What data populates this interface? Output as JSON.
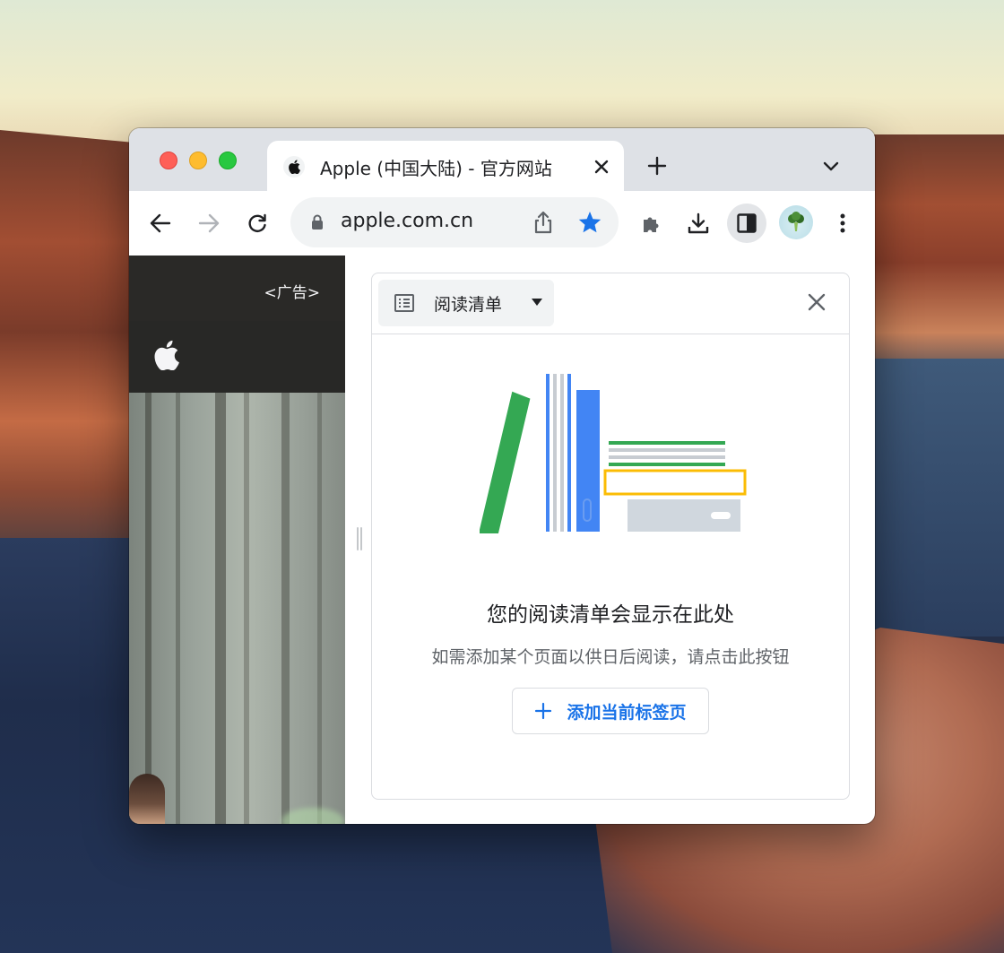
{
  "browser": {
    "tab": {
      "title": "Apple (中国大陆) - 官方网站",
      "favicon": "apple-icon"
    },
    "omnibox": {
      "url": "apple.com.cn"
    }
  },
  "page": {
    "promo_label": "<广告>"
  },
  "side_panel": {
    "selector_label": "阅读清单",
    "empty_title": "您的阅读清单会显示在此处",
    "empty_subtitle": "如需添加某个页面以供日后阅读，请点击此按钮",
    "add_button_label": "添加当前标签页"
  },
  "colors": {
    "accent": "#1a73e8",
    "star": "#1a73e8"
  }
}
